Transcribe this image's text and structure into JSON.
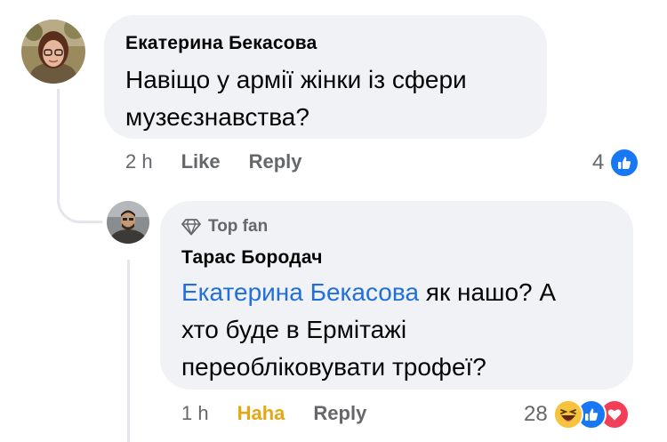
{
  "comment": {
    "author": "Екатерина Бекасова",
    "text_line1": "Навіщо у армії жінки із сфери",
    "text_line2": "музеєзнавства?",
    "time": "2 h",
    "like_label": "Like",
    "reply_label": "Reply",
    "reaction_count": "4",
    "reactions": [
      "like-icon"
    ]
  },
  "reply": {
    "badge": "Top fan",
    "author": "Тарас Бородач",
    "mention": "Екатерина Бекасова",
    "text_line1_rest": " як нашо? А",
    "text_line2": "хто буде в Ермітажі",
    "text_line3": "переобліковувати трофеї?",
    "time": "1 h",
    "reaction_label": "Haha",
    "reply_label": "Reply",
    "reaction_count": "28",
    "reactions": [
      "haha-icon",
      "like-icon",
      "love-icon"
    ]
  },
  "colors": {
    "bubble": "#f0f2f5",
    "mention": "#216fdb",
    "secondary_text": "#65676b",
    "haha": "#e5a715",
    "like": "#1877f2",
    "love": "#f33e58"
  }
}
